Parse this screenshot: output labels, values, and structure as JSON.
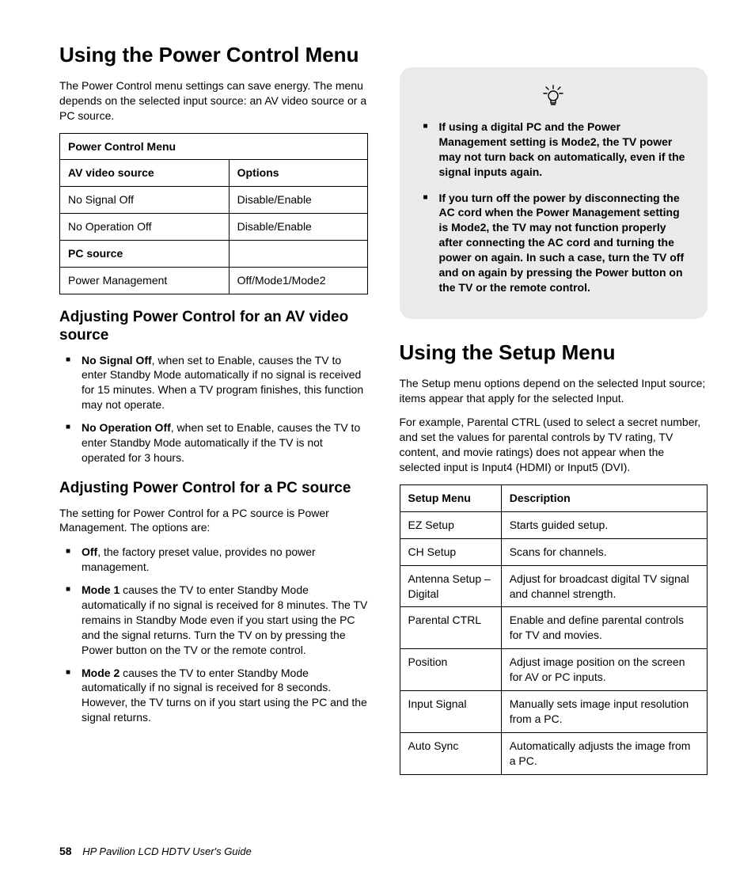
{
  "left": {
    "h1": "Using the Power Control Menu",
    "intro": "The Power Control menu settings can save energy. The menu depends on the selected input source: an AV video source or a PC source.",
    "table": {
      "title": "Power Control Menu",
      "h_av": "AV video source",
      "h_opt": "Options",
      "r1a": "No Signal Off",
      "r1b": "Disable/Enable",
      "r2a": "No Operation Off",
      "r2b": "Disable/Enable",
      "h_pc": "PC source",
      "r3a": "Power Management",
      "r3b": "Off/Mode1/Mode2"
    },
    "h2a": "Adjusting Power Control for an AV video source",
    "li1_b": "No Signal Off",
    "li1_t": ", when set to Enable, causes the TV to enter Standby Mode automatically if no signal is received for 15 minutes. When a TV program finishes, this function may not operate.",
    "li2_b": "No Operation Off",
    "li2_t": ", when set to Enable, causes the TV to enter Standby Mode automatically if the TV is not operated for 3 hours.",
    "h2b": "Adjusting Power Control for a PC source",
    "p2": "The setting for Power Control for a PC source is Power Management. The options are:",
    "li3_b": "Off",
    "li3_t": ", the factory preset value, provides no power management.",
    "li4_b": "Mode 1",
    "li4_t": " causes the TV to enter Standby Mode automatically if no signal is received for 8 minutes. The TV remains in Standby Mode even if you start using the PC and the signal returns. Turn the TV on by pressing the Power button on the TV or the remote control.",
    "li5_b": "Mode 2",
    "li5_t": " causes the TV to enter Standby Mode automatically if no signal is received for 8 seconds. However, the TV turns on if you start using the PC and the signal returns."
  },
  "right": {
    "note1": "If using a digital PC and the Power Management setting is Mode2, the TV power may not turn back on automatically, even if the signal inputs again.",
    "note2": "If you turn off the power by disconnecting the AC cord when the Power Management setting is Mode2, the TV may not function properly after connecting the AC cord and turning the power on again. In such a case, turn the TV off and on again by pressing the Power button on the TV or the remote control.",
    "h1": "Using the Setup Menu",
    "p1": "The Setup menu options depend on the selected Input source; items appear that apply for the selected Input.",
    "p2": "For example, Parental CTRL (used to select a secret number, and set the values for parental controls by TV rating, TV content, and movie ratings) does not appear when the selected input is Input4 (HDMI) or Input5 (DVI).",
    "table": {
      "h1": "Setup Menu",
      "h2": "Description",
      "r1a": "EZ Setup",
      "r1b": "Starts guided setup.",
      "r2a": "CH Setup",
      "r2b": "Scans for channels.",
      "r3a": "Antenna Setup – Digital",
      "r3b": "Adjust for broadcast digital TV signal and channel strength.",
      "r4a": "Parental CTRL",
      "r4b": "Enable and define parental controls for TV and movies.",
      "r5a": "Position",
      "r5b": "Adjust image position on the screen for AV or PC inputs.",
      "r6a": "Input Signal",
      "r6b": "Manually sets image input resolution from a PC.",
      "r7a": "Auto Sync",
      "r7b": "Automatically adjusts the image from a PC."
    }
  },
  "footer": {
    "page": "58",
    "title": "HP Pavilion LCD HDTV User's Guide"
  }
}
